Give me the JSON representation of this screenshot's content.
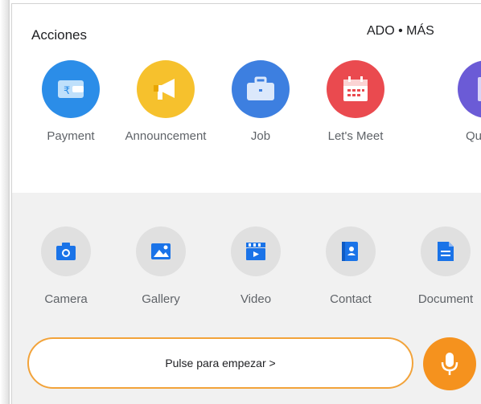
{
  "header": {
    "title": "Acciones",
    "right_link": "ADO • MÁS"
  },
  "actions": [
    {
      "label": "Payment",
      "icon": "rupee-wallet-icon",
      "color": "#2b8de8"
    },
    {
      "label": "Announcement",
      "icon": "megaphone-icon",
      "color": "#f6c12d"
    },
    {
      "label": "Job",
      "icon": "briefcase-icon",
      "color": "#3d7fe0"
    },
    {
      "label": "Let's Meet",
      "icon": "calendar-icon",
      "color": "#ea4a4f"
    },
    {
      "label": "Qui",
      "icon": "quiz-icon",
      "color": "#6b5bd6"
    }
  ],
  "attachments": [
    {
      "label": "Camera",
      "icon": "camera-icon"
    },
    {
      "label": "Gallery",
      "icon": "image-icon"
    },
    {
      "label": "Video",
      "icon": "clapperboard-icon"
    },
    {
      "label": "Contact",
      "icon": "contact-book-icon"
    },
    {
      "label": "Document",
      "icon": "document-icon"
    }
  ],
  "composer": {
    "start_label": "Pulse para empezar >",
    "mic_icon": "microphone-icon"
  },
  "colors": {
    "accent_orange": "#f5921e",
    "start_border": "#f2a33a",
    "attachment_icon": "#1a73e8"
  }
}
